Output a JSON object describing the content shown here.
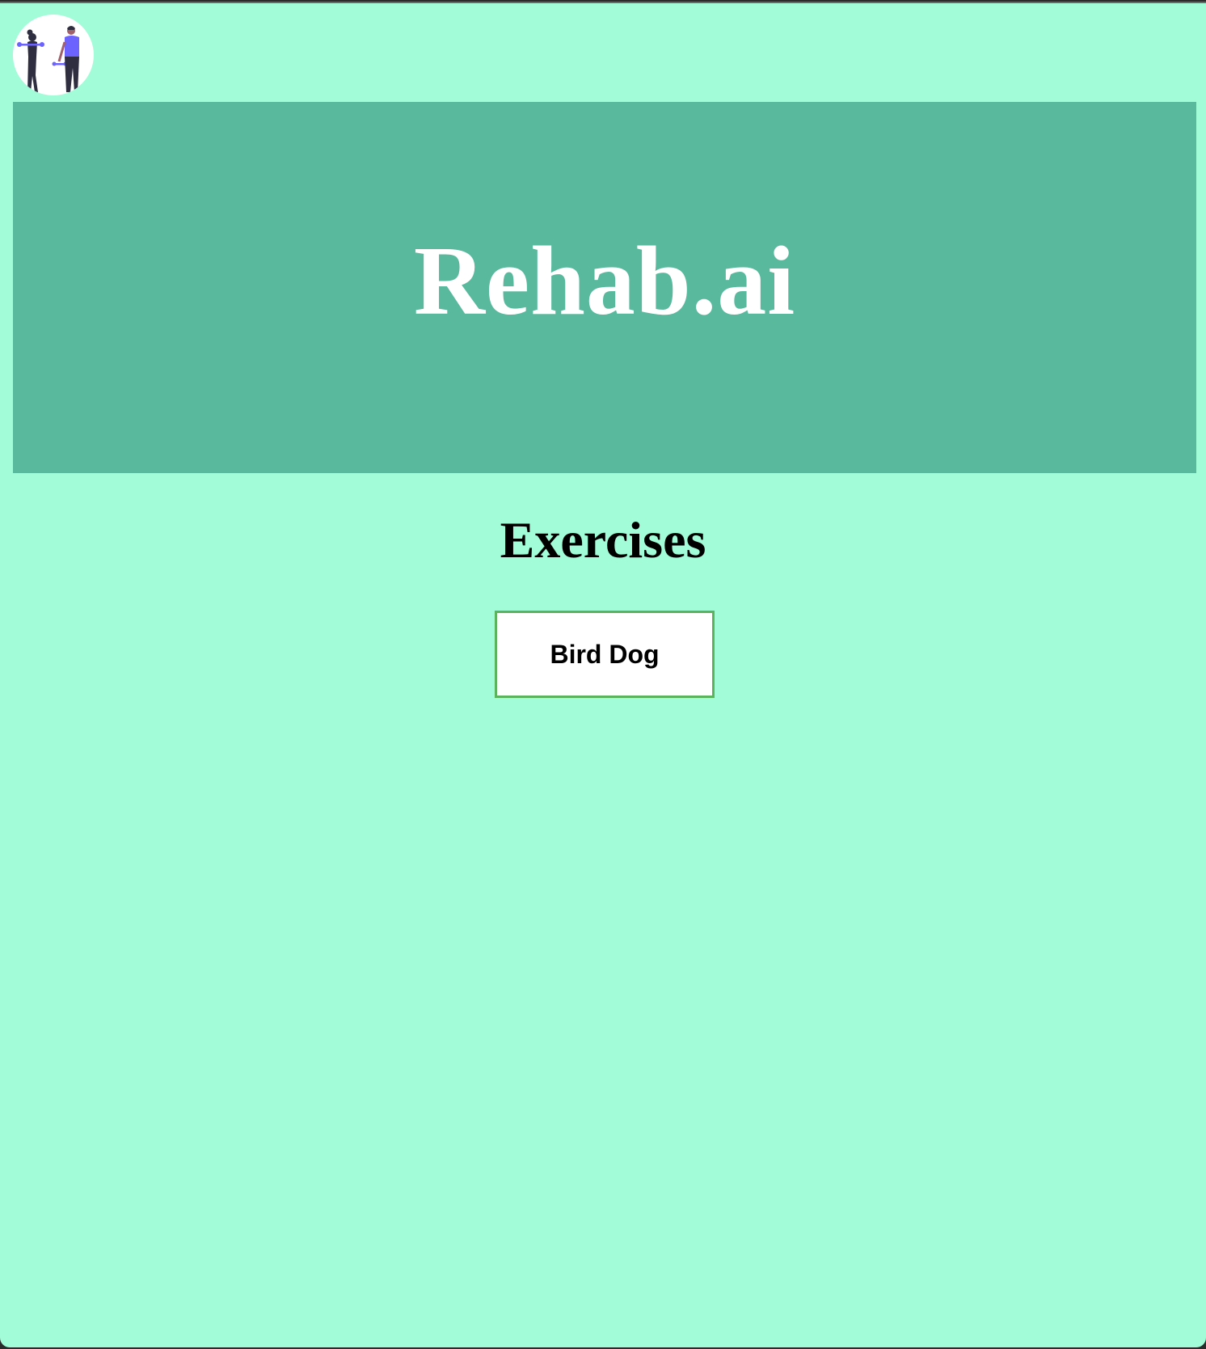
{
  "header": {
    "logo_icon": "exercise-illustration-icon"
  },
  "hero": {
    "title": "Rehab.ai"
  },
  "main": {
    "section_title": "Exercises",
    "exercises": [
      {
        "label": "Bird Dog"
      }
    ]
  },
  "colors": {
    "page_background": "#a2fcd8",
    "hero_background": "#59b99d",
    "button_border": "#5cb35e",
    "accent_purple": "#6c63ff"
  }
}
